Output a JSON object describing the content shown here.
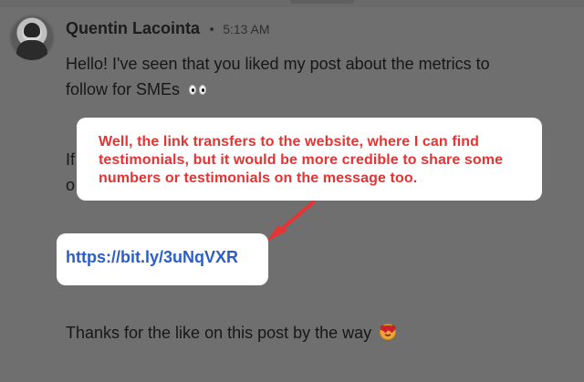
{
  "message": {
    "author": "Quentin Lacointa",
    "separator": "•",
    "time": "5:13 AM",
    "lines": [
      "Hello! I've seen that you liked my post about the metrics to",
      "follow for SMEs"
    ],
    "partial_hidden_lines": [
      "If",
      "o"
    ],
    "link_text": "https://bit.ly/3uNqVXR",
    "closing_line": "Thanks for the like on this post by the way"
  },
  "annotation": {
    "callout_text": "Well, the link transfers to the website, where I can find testimonials, but it would be more credible to share some numbers or testimonials on the message too.",
    "text_color": "#e63333",
    "box_color": "#ffffff",
    "arrow_color": "#e63333"
  },
  "icons": {
    "avatar": "user-avatar",
    "eyes": "eyes-emoji-icon",
    "smile": "heart-eyes-emoji-icon",
    "arrow": "callout-arrow-icon"
  },
  "colors": {
    "background": "#6f6f6f",
    "link": "#2b5fc7",
    "body_text": "#171717"
  }
}
